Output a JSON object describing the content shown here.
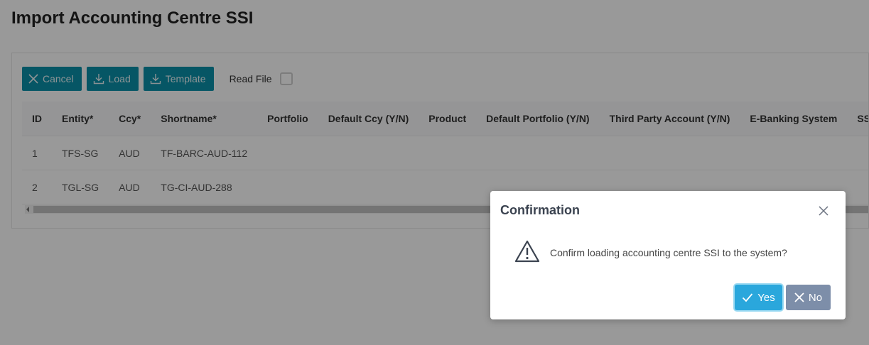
{
  "page": {
    "title": "Import Accounting Centre SSI"
  },
  "toolbar": {
    "cancel_label": "Cancel",
    "load_label": "Load",
    "template_label": "Template",
    "read_file_label": "Read File",
    "read_file_checked": false
  },
  "table": {
    "columns": [
      "ID",
      "Entity*",
      "Ccy*",
      "Shortname*",
      "Portfolio",
      "Default Ccy (Y/N)",
      "Product",
      "Default Portfolio (Y/N)",
      "Third Party Account (Y/N)",
      "E-Banking System",
      "SSI T"
    ],
    "rows": [
      [
        "1",
        "TFS-SG",
        "AUD",
        "TF-BARC-AUD-112",
        "",
        "",
        "",
        "",
        "",
        "",
        ""
      ],
      [
        "2",
        "TGL-SG",
        "AUD",
        "TG-CI-AUD-288",
        "",
        "",
        "",
        "",
        "",
        "",
        ""
      ]
    ]
  },
  "dialog": {
    "title": "Confirmation",
    "message": "Confirm loading accounting centre SSI to the system?",
    "yes_label": "Yes",
    "no_label": "No"
  },
  "colors": {
    "toolbar_button": "#0a8fa8",
    "yes_button": "#2aa7dc",
    "no_button": "#7d8ea9"
  },
  "icons": {
    "cancel": "close-icon",
    "load": "download-icon",
    "template": "download-icon",
    "dialog_close": "close-icon",
    "dialog_warning": "warning-icon",
    "yes": "check-icon",
    "no": "close-icon"
  }
}
